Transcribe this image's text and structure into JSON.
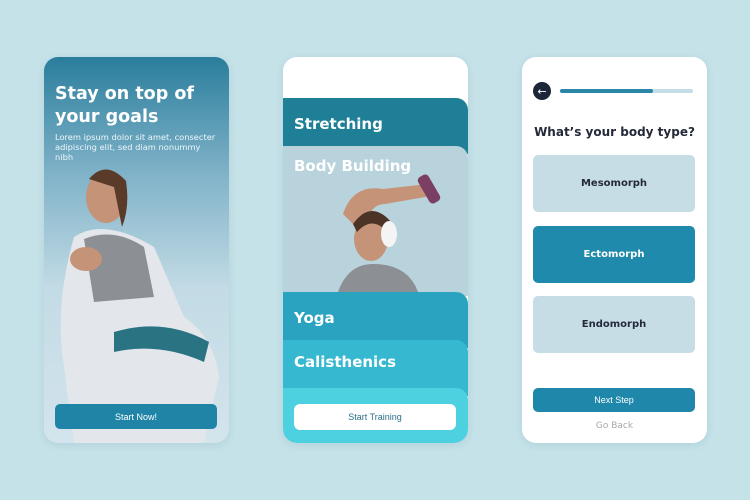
{
  "onboarding": {
    "title": "Stay on top of your goals",
    "subtitle": "Lorem ipsum dolor sit amet, consecter adipiscing elit, sed diam nonummy nibh",
    "button": "Start Now!"
  },
  "categories": {
    "items": [
      {
        "label": "Stretching",
        "color": "#1e7f96"
      },
      {
        "label": "Body Building",
        "color": "#b9d3dc"
      },
      {
        "label": "Yoga",
        "color": "#2aa3c0"
      },
      {
        "label": "Calisthenics",
        "color": "#36b8d0"
      }
    ],
    "button": "Start Training"
  },
  "quiz": {
    "back_icon": "arrow-left-icon",
    "progress": 0.7,
    "question": "What’s your body type?",
    "options": [
      {
        "label": "Mesomorph",
        "selected": false
      },
      {
        "label": "Ectomorph",
        "selected": true
      },
      {
        "label": "Endomorph",
        "selected": false
      }
    ],
    "next": "Next Step",
    "go_back": "Go Back"
  },
  "colors": {
    "accent": "#1f88aa",
    "background": "#c5e2e9"
  }
}
